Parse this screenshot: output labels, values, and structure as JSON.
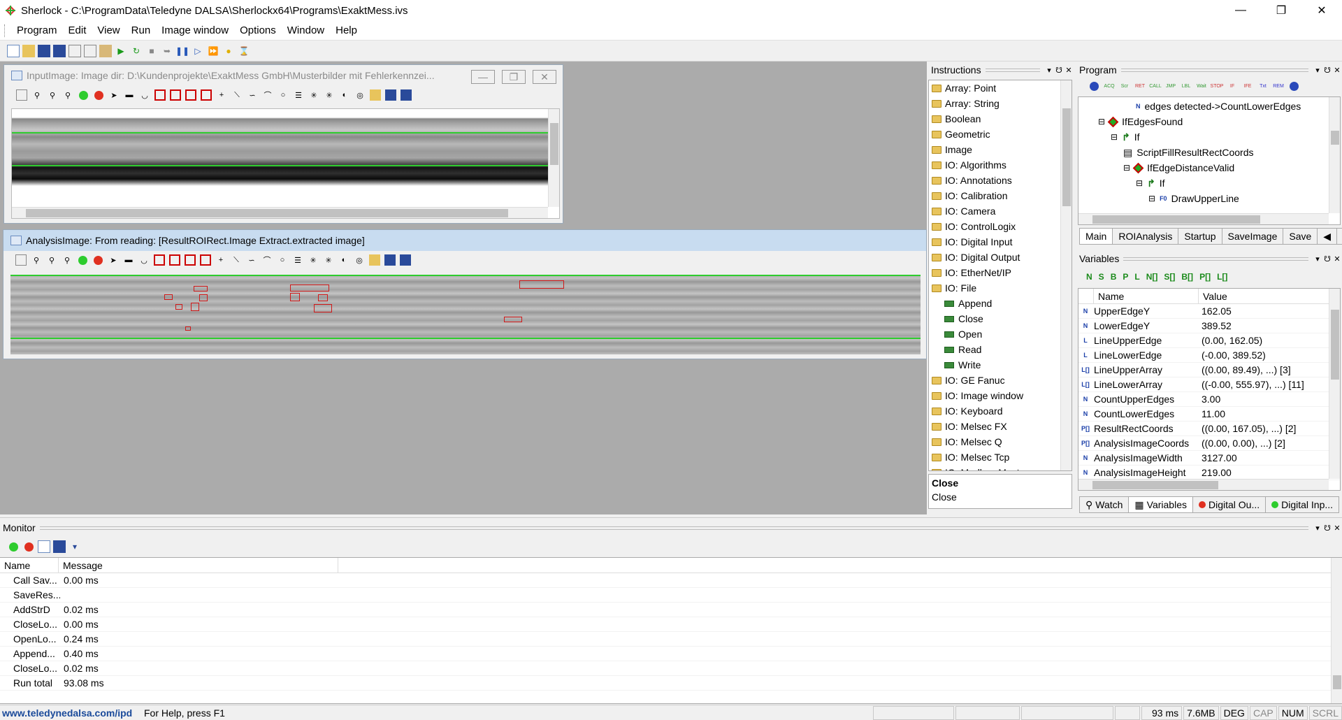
{
  "window": {
    "title": "Sherlock - C:\\ProgramData\\Teledyne DALSA\\Sherlockx64\\Programs\\ExaktMess.ivs"
  },
  "menu": [
    "Program",
    "Edit",
    "View",
    "Run",
    "Image window",
    "Options",
    "Window",
    "Help"
  ],
  "input_image": {
    "title": "InputImage: Image dir: D:\\Kundenprojekte\\ExaktMess GmbH\\Musterbilder mit Fehlerkennzei..."
  },
  "analysis_image": {
    "title": "AnalysisImage: From reading: [ResultROIRect.Image Extract.extracted image]"
  },
  "instructions": {
    "header": "Instructions",
    "items": [
      {
        "label": "Array: Point",
        "type": "folder"
      },
      {
        "label": "Array: String",
        "type": "folder"
      },
      {
        "label": "Boolean",
        "type": "folder"
      },
      {
        "label": "Geometric",
        "type": "folder"
      },
      {
        "label": "Image",
        "type": "folder"
      },
      {
        "label": "IO: Algorithms",
        "type": "folder"
      },
      {
        "label": "IO: Annotations",
        "type": "folder"
      },
      {
        "label": "IO: Calibration",
        "type": "folder"
      },
      {
        "label": "IO: Camera",
        "type": "folder"
      },
      {
        "label": "IO: ControlLogix",
        "type": "folder"
      },
      {
        "label": "IO: Digital Input",
        "type": "folder"
      },
      {
        "label": "IO: Digital Output",
        "type": "folder"
      },
      {
        "label": "IO: EtherNet/IP",
        "type": "folder"
      },
      {
        "label": "IO: File",
        "type": "folder"
      },
      {
        "label": "Append",
        "type": "sub"
      },
      {
        "label": "Close",
        "type": "sub"
      },
      {
        "label": "Open",
        "type": "sub"
      },
      {
        "label": "Read",
        "type": "sub"
      },
      {
        "label": "Write",
        "type": "sub"
      },
      {
        "label": "IO: GE Fanuc",
        "type": "folder"
      },
      {
        "label": "IO: Image window",
        "type": "folder"
      },
      {
        "label": "IO: Keyboard",
        "type": "folder"
      },
      {
        "label": "IO: Melsec FX",
        "type": "folder"
      },
      {
        "label": "IO: Melsec Q",
        "type": "folder"
      },
      {
        "label": "IO: Melsec Tcp",
        "type": "folder"
      },
      {
        "label": "IO: Modbus Master",
        "type": "folder"
      }
    ],
    "desc_title": "Close",
    "desc_text": "Close"
  },
  "program": {
    "header": "Program",
    "tree": [
      {
        "label": "edges detected->CountLowerEdges",
        "indent": 4,
        "icon": "N"
      },
      {
        "label": "IfEdgesFound",
        "indent": 1,
        "icon": "diamond"
      },
      {
        "label": "If",
        "indent": 2,
        "icon": "arrow"
      },
      {
        "label": "ScriptFillResultRectCoords",
        "indent": 3,
        "icon": "script"
      },
      {
        "label": "IfEdgeDistanceValid",
        "indent": 3,
        "icon": "diamond"
      },
      {
        "label": "If",
        "indent": 4,
        "icon": "arrow"
      },
      {
        "label": "DrawUpperLine",
        "indent": 5,
        "icon": "F0"
      }
    ],
    "tabs": [
      "Main",
      "ROIAnalysis",
      "Startup",
      "SaveImage",
      "Save"
    ]
  },
  "variables": {
    "header": "Variables",
    "filters": [
      "N",
      "S",
      "B",
      "P",
      "L",
      "N[]",
      "S[]",
      "B[]",
      "P[]",
      "L[]"
    ],
    "col_name": "Name",
    "col_value": "Value",
    "rows": [
      {
        "icon": "N",
        "name": "UpperEdgeY",
        "value": "162.05"
      },
      {
        "icon": "N",
        "name": "LowerEdgeY",
        "value": "389.52"
      },
      {
        "icon": "L",
        "name": "LineUpperEdge",
        "value": "(0.00, 162.05)"
      },
      {
        "icon": "L",
        "name": "LineLowerEdge",
        "value": "(-0.00, 389.52)"
      },
      {
        "icon": "L[]",
        "name": "LineUpperArray",
        "value": "((0.00, 89.49), ...) [3]"
      },
      {
        "icon": "L[]",
        "name": "LineLowerArray",
        "value": "((-0.00, 555.97), ...) [11]"
      },
      {
        "icon": "N",
        "name": "CountUpperEdges",
        "value": "3.00"
      },
      {
        "icon": "N",
        "name": "CountLowerEdges",
        "value": "11.00"
      },
      {
        "icon": "P[]",
        "name": "ResultRectCoords",
        "value": "((0.00, 167.05), ...) [2]"
      },
      {
        "icon": "P[]",
        "name": "AnalysisImageCoords",
        "value": "((0.00, 0.00), ...) [2]"
      },
      {
        "icon": "N",
        "name": "AnalysisImageWidth",
        "value": "3127.00"
      },
      {
        "icon": "N",
        "name": "AnalysisImageHeight",
        "value": "219.00"
      }
    ],
    "bottom_tabs": [
      "Watch",
      "Variables",
      "Digital Ou...",
      "Digital Inp..."
    ]
  },
  "monitor": {
    "header": "Monitor",
    "col_name": "Name",
    "col_message": "Message",
    "rows": [
      {
        "name": "Call Sav...",
        "message": "0.00 ms"
      },
      {
        "name": "SaveRes...",
        "message": ""
      },
      {
        "name": "AddStrD",
        "message": "0.02 ms"
      },
      {
        "name": "CloseLo...",
        "message": "0.00 ms"
      },
      {
        "name": "OpenLo...",
        "message": "0.24 ms"
      },
      {
        "name": "Append...",
        "message": "0.40 ms"
      },
      {
        "name": "CloseLo...",
        "message": "0.02 ms"
      },
      {
        "name": "Run total",
        "message": "93.08 ms"
      }
    ]
  },
  "status": {
    "link": "www.teledynedalsa.com/ipd",
    "help": "For Help, press F1",
    "time": "93 ms",
    "memory": "7.6MB",
    "units": "DEG",
    "cap": "CAP",
    "num": "NUM",
    "scrl": "SCRL"
  },
  "colors": {
    "accent": "#c8dcf0",
    "overlay_green": "#2ecc2e",
    "overlay_red": "#d01818",
    "link": "#1a4a9a"
  }
}
